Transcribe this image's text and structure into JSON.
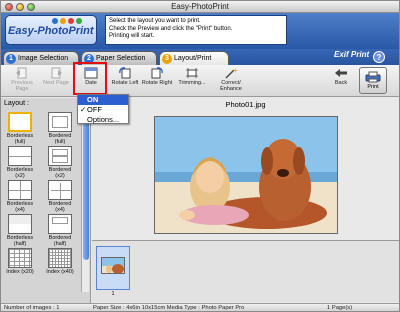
{
  "window": {
    "title": "Easy-PhotoPrint"
  },
  "banner": {
    "logo_text": "Easy-PhotoPrint",
    "instructions": [
      "Select the layout you want to print.",
      "Check the Preview and click the \"Print\" button.",
      "Printing will start."
    ]
  },
  "tabs": [
    {
      "number": "1",
      "label": "Image Selection",
      "color": "#2b6fd6"
    },
    {
      "number": "2",
      "label": "Paper Selection",
      "color": "#2b6fd6"
    },
    {
      "number": "3",
      "label": "Layout/Print",
      "color": "#f0a000"
    }
  ],
  "exif_label": "Exif Print",
  "help_label": "?",
  "toolbar": {
    "previous": "Previous Page",
    "next": "Next Page",
    "date": "Date",
    "rotate_left": "Rotate Left",
    "rotate_right": "Rotate Right",
    "trimming": "Trimming...",
    "correct": "Correct/ Enhance",
    "back": "Back",
    "print": "Print"
  },
  "date_menu": {
    "items": [
      "ON",
      "OFF",
      "Options..."
    ],
    "highlighted": "ON",
    "checked": "OFF",
    "check_mark": "✓"
  },
  "layout_panel": {
    "label": "Layout :",
    "items": [
      "Borderless (full)",
      "Bordered (full)",
      "Borderless (x2)",
      "Bordered (x2)",
      "Borderless (x4)",
      "Bordered (x4)",
      "Borderless (half)",
      "Bordered (half)",
      "Index (x20)",
      "Index (x40)"
    ]
  },
  "preview": {
    "filename": "Photo01.jpg"
  },
  "filmstrip": {
    "count": "1"
  },
  "status": {
    "images": "Number of images : 1",
    "paper": "Paper Size : 4x6in 10x15cm Media Type : Photo Paper Pro",
    "pages": "1 Page(s)"
  },
  "colors": {
    "banner": "#3566b4",
    "highlight": "#2b5fd1",
    "date_box": "#e01010"
  }
}
